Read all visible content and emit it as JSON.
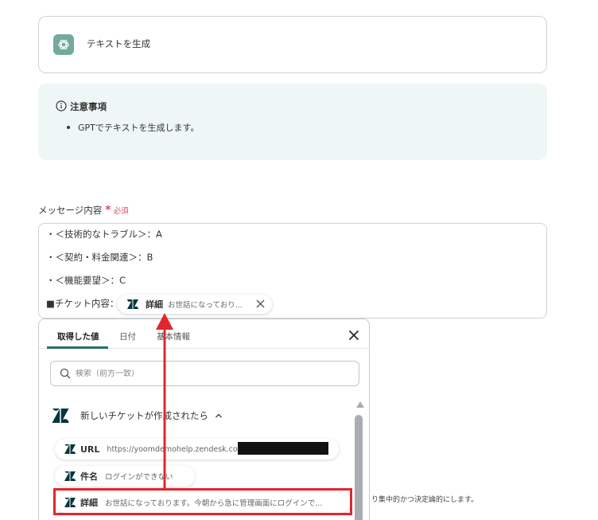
{
  "operation": {
    "title": "テキストを生成"
  },
  "notice": {
    "title": "注意事項",
    "bullet": "GPTでテキストを生成します。"
  },
  "message_field": {
    "label": "メッセージ内容",
    "required_mark": "*",
    "required_text": "必須",
    "lines": [
      "・＜技術的なトラブル＞：A",
      "・＜契約・料金関連＞：B",
      "・＜機能要望＞：C"
    ],
    "ticket_prefix": "■チケット内容：",
    "chip": {
      "label": "詳細",
      "value": "お世話になっており..."
    }
  },
  "panel": {
    "tabs": [
      "取得した値",
      "日付",
      "基本情報"
    ],
    "search_placeholder": "検索（前方一致）",
    "group_title": "新しいチケットが作成されたら",
    "items": [
      {
        "label": "URL",
        "value": "https://yoomdemohelp.zendesk.com"
      },
      {
        "label": "件名",
        "value": "ログインができない"
      },
      {
        "label": "詳細",
        "value": "お世話になっております。今朝から急に管理画面にログインで..."
      }
    ]
  },
  "background_hint": "り集中的かつ決定論的にします。",
  "colors": {
    "accent": "#2c6e6f",
    "highlight": "#e0272d",
    "openai": "#74aa9c",
    "required": "#e04b5a"
  }
}
